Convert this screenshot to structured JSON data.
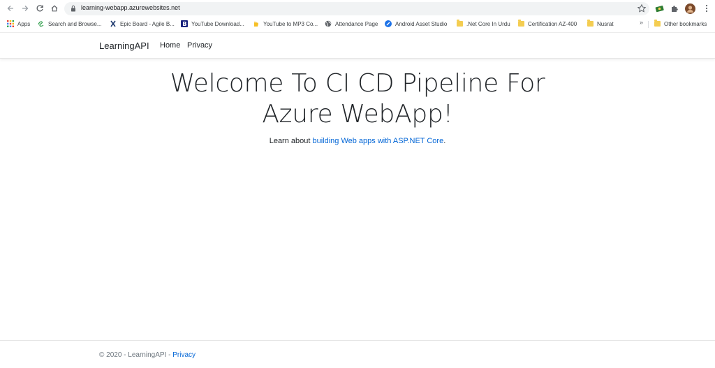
{
  "browser": {
    "url": "learning-webapp.azurewebsites.net",
    "bookmarks": [
      {
        "label": "Apps",
        "icon": "apps-grid-icon"
      },
      {
        "label": "Search and Browse...",
        "icon": "site-icon"
      },
      {
        "label": "Epic Board - Agile B...",
        "icon": "site-icon"
      },
      {
        "label": "YouTube Download...",
        "icon": "site-icon"
      },
      {
        "label": "YouTube to MP3 Co...",
        "icon": "site-icon"
      },
      {
        "label": "Attendance Page",
        "icon": "globe-icon"
      },
      {
        "label": "Android Asset Studio",
        "icon": "site-icon"
      },
      {
        "label": ".Net Core In Urdu",
        "icon": "folder-icon"
      },
      {
        "label": "Certification AZ-400",
        "icon": "folder-icon"
      },
      {
        "label": "Nusrat",
        "icon": "folder-icon"
      },
      {
        "label": "Other bookmarks",
        "icon": "folder-icon"
      }
    ],
    "overflow": "»"
  },
  "navbar": {
    "brand": "LearningAPI",
    "links": [
      "Home",
      "Privacy"
    ]
  },
  "hero": {
    "title": "Welcome To CI CD Pipeline For Azure WebApp!",
    "learn_prefix": "Learn about ",
    "learn_link": "building Web apps with ASP.NET Core",
    "learn_suffix": "."
  },
  "footer": {
    "copyright": "© 2020 - LearningAPI - ",
    "privacy": "Privacy"
  },
  "colors": {
    "link": "#0366d6",
    "text": "#212529",
    "muted": "#6c757d"
  }
}
